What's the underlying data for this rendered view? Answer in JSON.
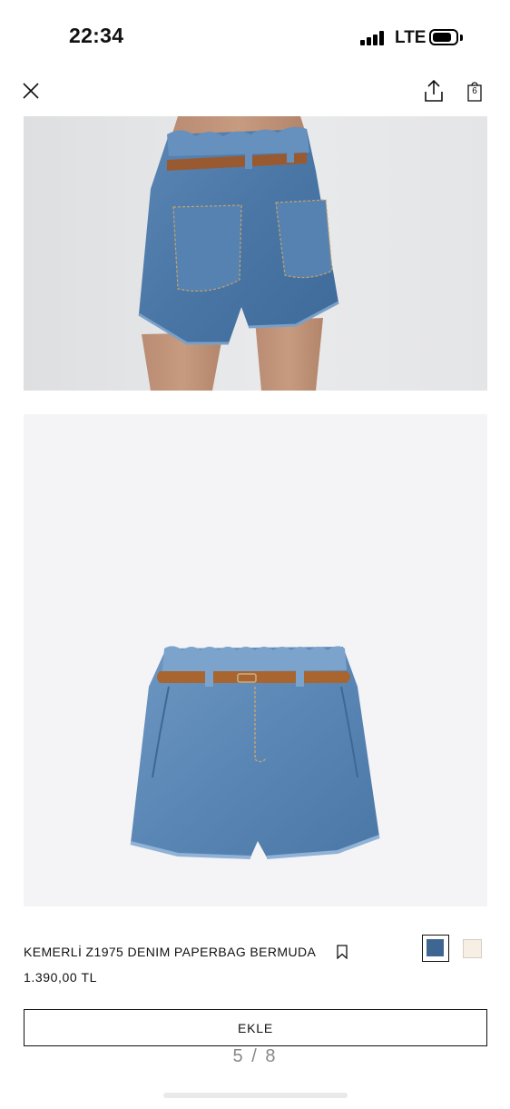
{
  "status_bar": {
    "time": "22:34",
    "network": "LTE",
    "icons": [
      "signal-icon",
      "battery-icon"
    ]
  },
  "nav": {
    "icons": [
      "close-icon",
      "share-icon",
      "shopping-bag-icon"
    ],
    "bag_count": "6"
  },
  "gallery": {
    "pager": "5 / 8"
  },
  "product": {
    "title": "KEMERLİ Z1975 DENIM PAPERBAG BERMUDA",
    "price": "1.390,00 TL",
    "colors": [
      {
        "name": "blue",
        "hex": "#3f6591",
        "selected": true
      },
      {
        "name": "cream",
        "hex": "#f7efe3",
        "selected": false
      }
    ]
  },
  "actions": {
    "add_label": "EKLE"
  }
}
